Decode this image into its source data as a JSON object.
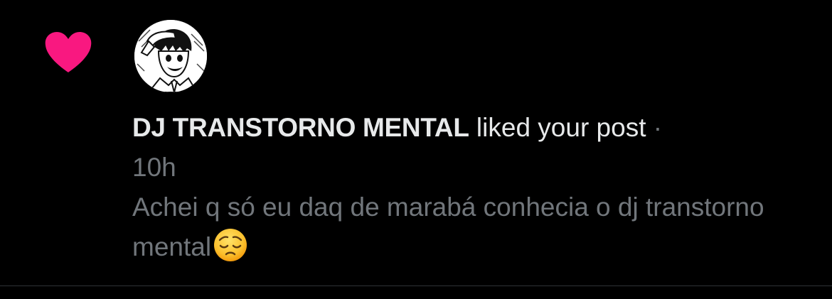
{
  "notification": {
    "type": "like",
    "actor_name": "DJ TRANSTORNO MENTAL",
    "action_text": "liked your post",
    "separator": "·",
    "timestamp": "10h",
    "post_text": "Achei q só eu daq de marabá conhecia o dj transtorno mental",
    "post_emoji": "pensive-face-emoji",
    "icon": "heart-icon",
    "avatar": "anime-character-saluting-avatar"
  },
  "colors": {
    "background": "#000000",
    "heart": "#f91880",
    "primary_text": "#e7e9ea",
    "secondary_text": "#71767b",
    "divider": "#2f3336"
  }
}
